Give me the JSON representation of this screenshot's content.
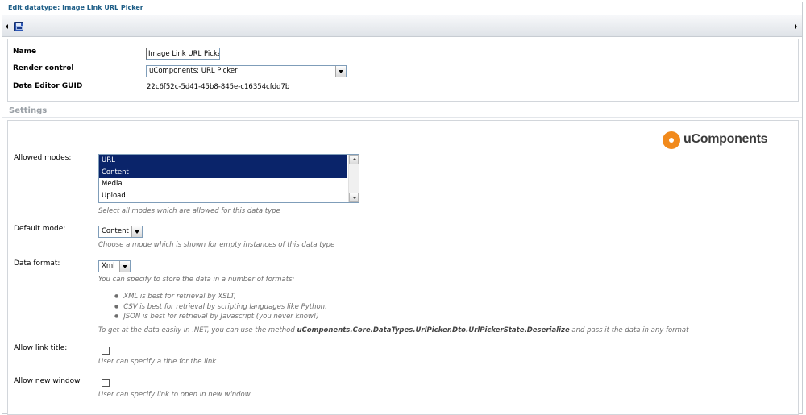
{
  "window": {
    "title": "Edit datatype: Image Link URL Picker"
  },
  "properties": {
    "name_label": "Name",
    "name_value": "Image Link URL Picker",
    "render_control_label": "Render control",
    "render_control_value": "uComponents: URL Picker",
    "guid_label": "Data Editor GUID",
    "guid_value": "22c6f52c-5d41-45b8-845e-c16354cfdd7b"
  },
  "settings": {
    "heading": "Settings",
    "logo_text": "uComponents",
    "allowed_modes": {
      "label": "Allowed modes:",
      "options": [
        {
          "label": "URL",
          "selected": true
        },
        {
          "label": "Content",
          "selected": true
        },
        {
          "label": "Media",
          "selected": false
        },
        {
          "label": "Upload",
          "selected": false
        }
      ],
      "hint": "Select all modes which are allowed for this data type"
    },
    "default_mode": {
      "label": "Default mode:",
      "value": "Content",
      "hint": "Choose a mode which is shown for empty instances of this data type"
    },
    "data_format": {
      "label": "Data format:",
      "value": "Xml",
      "hint_intro": "You can specify to store the data in a number of formats:",
      "bullets": [
        "XML is best for retrieval by XSLT,",
        "CSV is best for retrieval by scripting languages like Python,",
        "JSON is best for retrieval by Javascript (you never know!)"
      ],
      "net_hint_prefix": "To get at the data easily in .NET, you can use the method ",
      "net_hint_method": "uComponents.Core.DataTypes.UrlPicker.Dto.UrlPickerState.Deserialize",
      "net_hint_suffix": " and pass it the data in any format"
    },
    "allow_link_title": {
      "label": "Allow link title:",
      "checked": false,
      "hint": "User can specify a title for the link"
    },
    "allow_new_window": {
      "label": "Allow new window:",
      "checked": false,
      "hint": "User can specify link to open in new window"
    }
  }
}
